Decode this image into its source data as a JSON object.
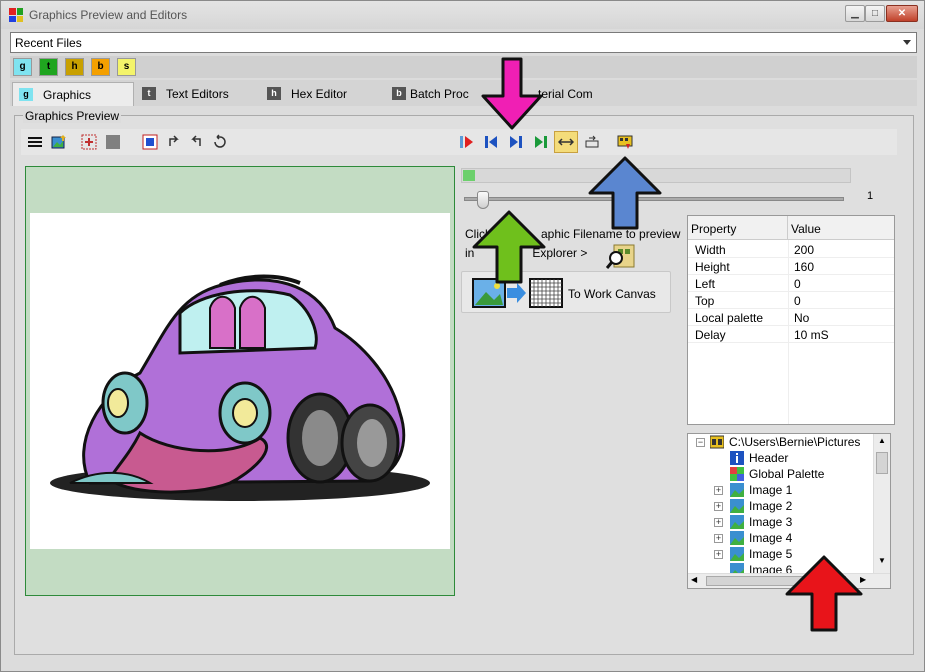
{
  "window": {
    "title": "Graphics Preview and Editors"
  },
  "recent_files": {
    "label": "Recent Files"
  },
  "mini_tabs": [
    {
      "letter": "g",
      "color": "#7fe3f0"
    },
    {
      "letter": "t",
      "color": "#1fa51f"
    },
    {
      "letter": "h",
      "color": "#c8a000"
    },
    {
      "letter": "b",
      "color": "#f4a000"
    },
    {
      "letter": "s",
      "color": "#f4f46a"
    }
  ],
  "tabs": [
    {
      "icon": "g",
      "label": "Graphics"
    },
    {
      "icon": "t",
      "label": "Text Editors"
    },
    {
      "icon": "h",
      "label": "Hex Editor"
    },
    {
      "icon": "b",
      "label": "Batch Proc"
    },
    {
      "label": "terial Com"
    }
  ],
  "group_label": "Graphics Preview",
  "toolbar_icons": [
    "menu-icon",
    "open-image-icon",
    "select-grid-icon",
    "stop-icon",
    "frame-icon",
    "rotate-left-icon",
    "rotate-right-icon",
    "reset-icon",
    "first-frame-icon",
    "prev-frame-icon",
    "next-frame-icon",
    "last-frame-icon",
    "loop-icon",
    "step-icon",
    "film-export-icon"
  ],
  "animation": {
    "progress": 0.02,
    "slider_value": "1",
    "slider_fraction": 0.03
  },
  "hint": {
    "line1": "Click",
    "line1b": "aphic Filename to preview",
    "line2": "in",
    "line2b": "Explorer >"
  },
  "work_canvas_label": "To Work Canvas",
  "properties": {
    "col_property": "Property",
    "col_value": "Value",
    "rows": [
      {
        "name": "Width",
        "value": "200"
      },
      {
        "name": "Height",
        "value": "160"
      },
      {
        "name": "Left",
        "value": "0"
      },
      {
        "name": "Top",
        "value": "0"
      },
      {
        "name": "Local palette",
        "value": "No"
      },
      {
        "name": "Delay",
        "value": "10 mS"
      }
    ]
  },
  "tree": {
    "root": "C:\\Users\\Bernie\\Pictures",
    "items": [
      "Header",
      "Global Palette",
      "Image 1",
      "Image 2",
      "Image 3",
      "Image 4",
      "Image 5",
      "Image 6"
    ]
  },
  "colors": {
    "arrow_magenta": "#f01fb4",
    "arrow_blue": "#5a86d0",
    "arrow_green": "#6fc01c",
    "arrow_red": "#e8141a",
    "preview_bg": "#c3dcc3"
  }
}
